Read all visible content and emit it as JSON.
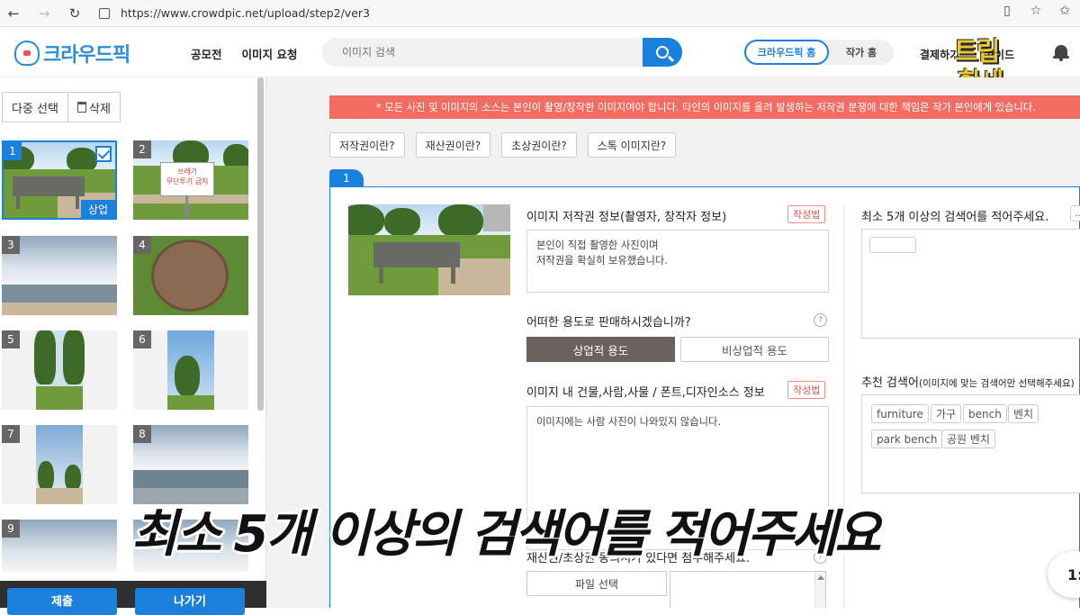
{
  "browser": {
    "url": "https://www.crowdpic.net/upload/step2/ver3",
    "back_icon": "←",
    "forward_icon": "→",
    "reload_icon": "↻"
  },
  "header": {
    "logo_text": "크라우드픽",
    "nav": [
      "공모전",
      "이미지 요청"
    ],
    "search_placeholder": "이미지 검색",
    "toggle_active": "크라우드픽 홈",
    "toggle_inactive": "작가 홈",
    "pay_link": "결제하기",
    "guide_link": "가이드",
    "watermark_line1": "트립",
    "watermark_line2": "한세"
  },
  "left_panel": {
    "multi_select_label": "다중 선택",
    "delete_label": "삭제",
    "thumbnails": [
      {
        "num": "1",
        "selected": true,
        "tag": "상업"
      },
      {
        "num": "2",
        "sign_text": "쓰레기\n무단투기 금지"
      },
      {
        "num": "3"
      },
      {
        "num": "4"
      },
      {
        "num": "5"
      },
      {
        "num": "6"
      },
      {
        "num": "7"
      },
      {
        "num": "8"
      },
      {
        "num": "9"
      }
    ],
    "submit_label": "제출",
    "exit_label": "나가기"
  },
  "main": {
    "notice": "* 모든 사진 및 이미지의 소스는 본인이 촬영/창작한 이미지여야 합니다. 타인의 이미지를 올려 발생하는 저작권 분쟁에 대한 책임은 작가 본인에게 있습니다.",
    "question_buttons": [
      "저작권이란?",
      "재산권이란?",
      "초상권이란?",
      "스톡 이미지란?"
    ],
    "card_tab": "1",
    "copyright_label": "이미지 저작권 정보(촬영자, 창작자 정보)",
    "badge_label": "작성법",
    "copyright_text": "본인이 직접 촬영한 사진이며\n저작권을 확실히 보유했습니다.",
    "usage_question": "어떠한 용도로 판매하시겠습니까?",
    "usage_commercial": "상업적 용도",
    "usage_noncommercial": "비상업적 용도",
    "building_label": "이미지 내 건물,사람,사물 / 폰트,디자인소스 정보",
    "building_text": "이미지에는 사람 사진이 나와있지 않습니다.",
    "attach_label": "재산권/초상권 동의서가 있다면 첨부해주세요.",
    "file_button": "파일 선택",
    "keywords_label": "최소 5개 이상의 검색어를 적어주세요.",
    "more_label": "...",
    "recommend_label": "추천 검색어",
    "recommend_sub": "(이미지에 맞는 검색어만 선택해주세요)",
    "recommend_chips": [
      "furniture",
      "가구",
      "bench",
      "벤치",
      "park bench",
      "공원 벤치"
    ],
    "help_mark": "?"
  },
  "caption": "최소 5개 이상의 검색어를 적어주세요",
  "fab_text": "1:"
}
